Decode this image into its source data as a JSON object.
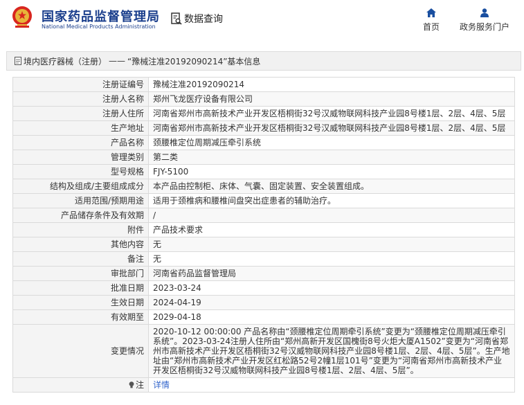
{
  "header": {
    "logo_cn": "国家药品监督管理局",
    "logo_en": "National Medical Products Administration",
    "data_query": "数据查询",
    "nav": {
      "home": "首页",
      "portal": "政务服务门户"
    }
  },
  "breadcrumb": {
    "category": "境内医疗器械（注册）",
    "separator": "——",
    "title": "“豫械注准20192090214”基本信息"
  },
  "rows": [
    {
      "label": "注册证编号",
      "value": "豫械注准20192090214"
    },
    {
      "label": "注册人名称",
      "value": "郑州飞龙医疗设备有限公司"
    },
    {
      "label": "注册人住所",
      "value": "河南省郑州市高新技术产业开发区梧桐街32号汉威物联网科技产业园8号楼1层、2层、4层、5层"
    },
    {
      "label": "生产地址",
      "value": "河南省郑州市高新技术产业开发区梧桐街32号汉威物联网科技产业园8号楼1层、2层、4层、5层"
    },
    {
      "label": "产品名称",
      "value": "颈腰椎定位周期减压牵引系统"
    },
    {
      "label": "管理类别",
      "value": "第二类"
    },
    {
      "label": "型号规格",
      "value": "FJY-5100"
    },
    {
      "label": "结构及组成/主要组成成分",
      "value": "本产品由控制柜、床体、气囊、固定装置、安全装置组成。"
    },
    {
      "label": "适用范围/预期用途",
      "value": "适用于颈椎病和腰椎间盘突出症患者的辅助治疗。"
    },
    {
      "label": "产品储存条件及有效期",
      "value": "/"
    },
    {
      "label": "附件",
      "value": "产品技术要求"
    },
    {
      "label": "其他内容",
      "value": "无"
    },
    {
      "label": "备注",
      "value": "无"
    },
    {
      "label": "审批部门",
      "value": "河南省药品监督管理局"
    },
    {
      "label": "批准日期",
      "value": "2023-03-24"
    },
    {
      "label": "生效日期",
      "value": "2024-04-19"
    },
    {
      "label": "有效期至",
      "value": "2029-04-18"
    },
    {
      "label": "变更情况",
      "value": "2020-10-12 00:00:00 产品名称由“颈腰椎定位周期牵引系统”变更为“颈腰椎定位周期减压牵引系统”。2023-03-24注册人住所由“郑州高新开发区国槐街8号火炬大厦A1502”变更为“河南省郑州市高新技术产业开发区梧桐街32号汉威物联网科技产业园8号楼1层、2层、4层、5层”。生产地址由“郑州市高新技术产业开发区红松路52号2幢1层101号”变更为“河南省郑州市高新技术产业开发区梧桐街32号汉威物联网科技产业园8号楼1层、2层、4层、5层”。"
    }
  ],
  "note": {
    "label": "注",
    "link": "详情"
  }
}
